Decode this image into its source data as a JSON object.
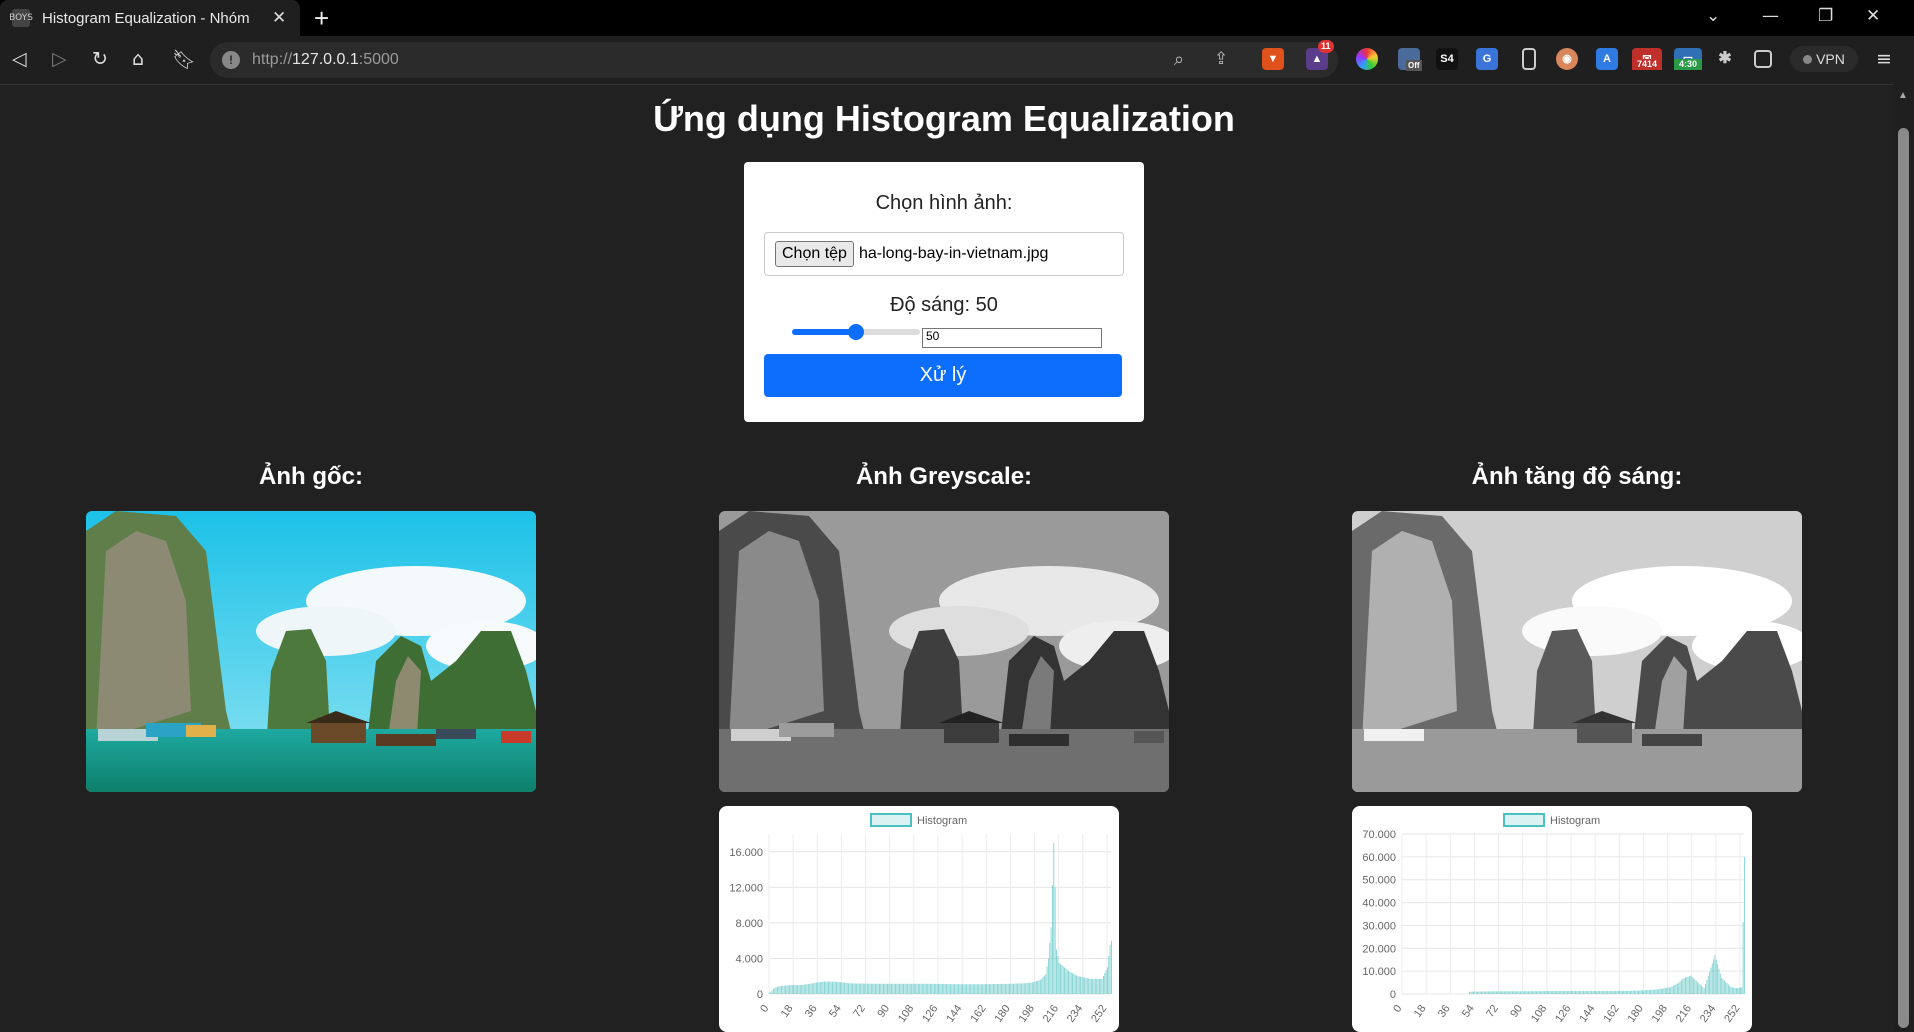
{
  "browser": {
    "tab_title": "Histogram Equalization - Nhóm",
    "tab_icon_text": "BOYS",
    "url_scheme": "http://",
    "url_host": "127.0.0.1",
    "url_port": ":5000",
    "vpn_label": "VPN",
    "ext_badges": [
      "11",
      "S4",
      "7414",
      "4:30",
      "Off"
    ]
  },
  "page": {
    "title": "Ứng dụng Histogram Equalization"
  },
  "form": {
    "choose_label": "Chọn hình ảnh:",
    "file_button": "Chọn tệp",
    "file_name": "ha-long-bay-in-vietnam.jpg",
    "brightness_label": "Độ sáng: 50",
    "brightness_value": 50,
    "brightness_fraction": 0.5,
    "number_value": "50",
    "submit_label": "Xử lý",
    "accent": "#0d6efd"
  },
  "columns": {
    "original_title": "Ảnh gốc:",
    "grey_title": "Ảnh Greyscale:",
    "bright_title": "Ảnh tăng độ sáng:"
  },
  "chart_data": [
    {
      "type": "bar",
      "legend": "Histogram",
      "ylim": [
        0,
        18000
      ],
      "y_ticks": [
        "0",
        "4.000",
        "8.000",
        "12.000",
        "16.000"
      ],
      "y_tick_values": [
        0,
        4000,
        8000,
        12000,
        16000
      ],
      "x_ticks": [
        "0",
        "18",
        "36",
        "54",
        "72",
        "90",
        "108",
        "126",
        "144",
        "162",
        "180",
        "198",
        "216",
        "234",
        "252"
      ],
      "points": [
        [
          0,
          100
        ],
        [
          4,
          700
        ],
        [
          8,
          900
        ],
        [
          16,
          1000
        ],
        [
          24,
          1000
        ],
        [
          32,
          1200
        ],
        [
          40,
          1400
        ],
        [
          48,
          1400
        ],
        [
          60,
          1200
        ],
        [
          80,
          1150
        ],
        [
          100,
          1150
        ],
        [
          120,
          1150
        ],
        [
          140,
          1100
        ],
        [
          160,
          1100
        ],
        [
          180,
          1150
        ],
        [
          190,
          1200
        ],
        [
          196,
          1300
        ],
        [
          202,
          1600
        ],
        [
          206,
          2200
        ],
        [
          208,
          4000
        ],
        [
          210,
          7500
        ],
        [
          212,
          17000
        ],
        [
          213,
          12000
        ],
        [
          214,
          5000
        ],
        [
          216,
          3500
        ],
        [
          220,
          3000
        ],
        [
          224,
          2500
        ],
        [
          230,
          2000
        ],
        [
          240,
          1700
        ],
        [
          248,
          1700
        ],
        [
          252,
          3000
        ],
        [
          254,
          5500
        ],
        [
          255,
          6000
        ]
      ],
      "color": "#4bc0c0"
    },
    {
      "type": "bar",
      "legend": "Histogram",
      "ylim": [
        0,
        70000
      ],
      "y_ticks": [
        "0",
        "10.000",
        "20.000",
        "30.000",
        "40.000",
        "50.000",
        "60.000",
        "70.000"
      ],
      "y_tick_values": [
        0,
        10000,
        20000,
        30000,
        40000,
        50000,
        60000,
        70000
      ],
      "x_ticks": [
        "0",
        "18",
        "36",
        "54",
        "72",
        "90",
        "108",
        "126",
        "144",
        "162",
        "180",
        "198",
        "216",
        "234",
        "252"
      ],
      "points": [
        [
          50,
          1000
        ],
        [
          70,
          1200
        ],
        [
          90,
          1200
        ],
        [
          110,
          1300
        ],
        [
          130,
          1300
        ],
        [
          150,
          1300
        ],
        [
          170,
          1400
        ],
        [
          180,
          1600
        ],
        [
          190,
          2000
        ],
        [
          200,
          3000
        ],
        [
          205,
          4500
        ],
        [
          210,
          7000
        ],
        [
          215,
          8000
        ],
        [
          225,
          2500
        ],
        [
          233,
          17000
        ],
        [
          238,
          7000
        ],
        [
          245,
          3000
        ],
        [
          250,
          2500
        ],
        [
          253,
          3000
        ],
        [
          255,
          60000
        ]
      ],
      "color": "#4bc0c0"
    }
  ]
}
